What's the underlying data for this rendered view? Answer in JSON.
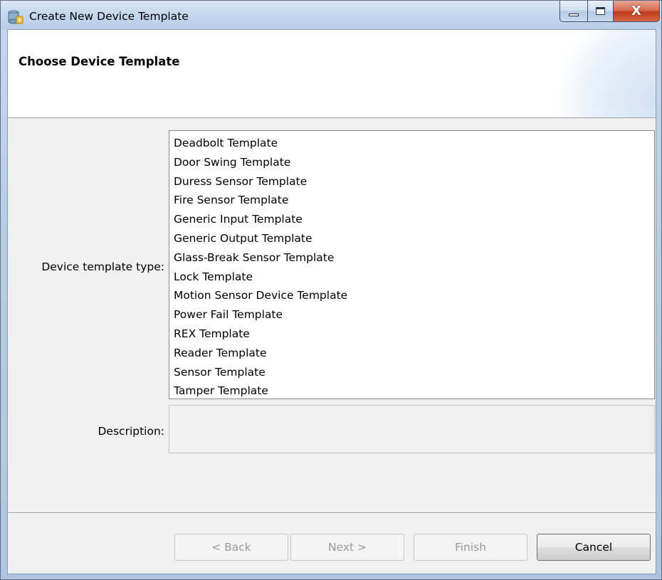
{
  "window": {
    "title": "Create New Device Template",
    "controls": {
      "minimize_icon": "minimize-icon",
      "maximize_icon": "maximize-icon",
      "close_glyph": "X"
    }
  },
  "wizard": {
    "page_title": "Choose Device Template",
    "device_template_type_label": "Device template type:",
    "description_label": "Description:",
    "description_value": "",
    "templates": [
      "Deadbolt Template",
      "Door Swing Template",
      "Duress Sensor Template",
      "Fire Sensor Template",
      "Generic Input Template",
      "Generic Output Template",
      "Glass-Break Sensor Template",
      "Lock Template",
      "Motion Sensor Device Template",
      "Power Fail Template",
      "REX Template",
      "Reader Template",
      "Sensor Template",
      "Tamper Template"
    ]
  },
  "buttons": {
    "back": "< Back",
    "next": "Next >",
    "finish": "Finish",
    "cancel": "Cancel"
  },
  "colors": {
    "titlebar": "#c4d7ee",
    "close_button": "#c1391c",
    "client_background": "#f0f0f0",
    "disabled_text": "#9a9a9a"
  }
}
